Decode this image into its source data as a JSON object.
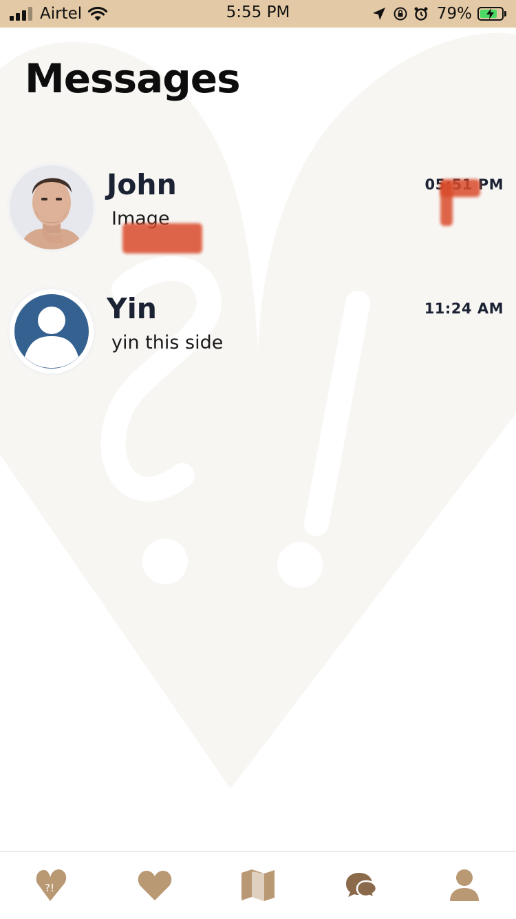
{
  "status_bar": {
    "carrier": "Airtel",
    "time": "5:55 PM",
    "battery_percent": "79%",
    "battery_level": 0.79,
    "icons": [
      "signal-bars-icon",
      "wifi-icon",
      "location-arrow-icon",
      "orientation-lock-icon",
      "alarm-icon",
      "battery-charging-icon"
    ]
  },
  "header": {
    "title": "Messages"
  },
  "conversations": [
    {
      "name": "John",
      "preview": "Image",
      "time": "05:51 PM",
      "avatar": "photo-avatar"
    },
    {
      "name": "Yin",
      "preview": "yin this side",
      "time": "11:24 AM",
      "avatar": "default-user-avatar"
    }
  ],
  "tab_bar": {
    "tabs": [
      {
        "icon": "question-heart-icon",
        "active": false
      },
      {
        "icon": "heart-icon",
        "active": false
      },
      {
        "icon": "map-icon",
        "active": false
      },
      {
        "icon": "chat-bubbles-icon",
        "active": true
      },
      {
        "icon": "profile-icon",
        "active": false
      }
    ]
  },
  "colors": {
    "status_bar_bg": "#e3c9a5",
    "tab_icon": "#b99874",
    "tab_icon_active": "#8a6a4a",
    "text_dark": "#1b2233",
    "avatar_blue": "#34618f",
    "watermark": "#f8f6f3"
  }
}
